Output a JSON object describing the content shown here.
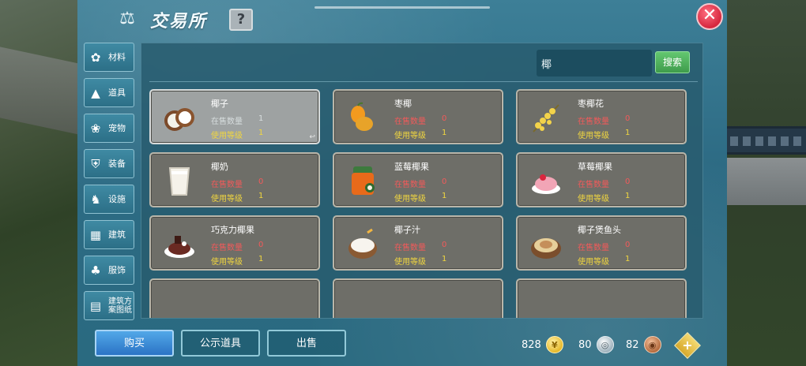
{
  "window": {
    "title": "交易所",
    "help_label": "?",
    "close_label": "✕"
  },
  "side_tabs": [
    {
      "label": "材料",
      "icon": "materials-icon",
      "glyph": "✿"
    },
    {
      "label": "道具",
      "icon": "tool-icon",
      "glyph": "▲"
    },
    {
      "label": "宠物",
      "icon": "paw-icon",
      "glyph": "❀"
    },
    {
      "label": "装备",
      "icon": "armor-icon",
      "glyph": "⛨"
    },
    {
      "label": "设施",
      "icon": "facility-icon",
      "glyph": "♞"
    },
    {
      "label": "建筑",
      "icon": "building-icon",
      "glyph": "▦"
    },
    {
      "label": "服饰",
      "icon": "clothing-icon",
      "glyph": "♣"
    },
    {
      "label": "建筑方\n案图纸",
      "icon": "blueprint-icon",
      "glyph": "▤"
    }
  ],
  "search": {
    "value": "椰",
    "button_label": "搜索"
  },
  "items": [
    {
      "name": "椰子",
      "sale_label": "在售数量",
      "sale_value": "1",
      "level_label": "使用等级",
      "level_value": "1",
      "selected": true,
      "icon": "coconut-icon",
      "corner": "↩"
    },
    {
      "name": "枣椰",
      "sale_label": "在售数量",
      "sale_value": "0",
      "level_label": "使用等级",
      "level_value": "1",
      "selected": false,
      "icon": "date-palm-fruit-icon"
    },
    {
      "name": "枣椰花",
      "sale_label": "在售数量",
      "sale_value": "0",
      "level_label": "使用等级",
      "level_value": "1",
      "selected": false,
      "icon": "date-palm-flower-icon"
    },
    {
      "name": "椰奶",
      "sale_label": "在售数量",
      "sale_value": "0",
      "level_label": "使用等级",
      "level_value": "1",
      "selected": false,
      "icon": "coconut-milk-icon"
    },
    {
      "name": "蓝莓椰果",
      "sale_label": "在售数量",
      "sale_value": "0",
      "level_label": "使用等级",
      "level_value": "1",
      "selected": false,
      "icon": "blueberry-jelly-icon"
    },
    {
      "name": "草莓椰果",
      "sale_label": "在售数量",
      "sale_value": "0",
      "level_label": "使用等级",
      "level_value": "1",
      "selected": false,
      "icon": "strawberry-jelly-icon"
    },
    {
      "name": "巧克力椰果",
      "sale_label": "在售数量",
      "sale_value": "0",
      "level_label": "使用等级",
      "level_value": "1",
      "selected": false,
      "icon": "chocolate-jelly-icon"
    },
    {
      "name": "椰子汁",
      "sale_label": "在售数量",
      "sale_value": "0",
      "level_label": "使用等级",
      "level_value": "1",
      "selected": false,
      "icon": "coconut-juice-icon"
    },
    {
      "name": "椰子煲鱼头",
      "sale_label": "在售数量",
      "sale_value": "0",
      "level_label": "使用等级",
      "level_value": "1",
      "selected": false,
      "icon": "fish-head-soup-icon"
    }
  ],
  "bottom": {
    "buy_label": "购买",
    "public_label": "公示道具",
    "sell_label": "出售",
    "gold": "828",
    "silver": "80",
    "copper": "82",
    "add_label": "+"
  },
  "colors": {
    "accent_blue": "#2b73c5",
    "search_green": "#3f9c4c",
    "sale_red": "#f15a5a",
    "level_yellow": "#f0d640",
    "close_red": "#d6273e"
  }
}
